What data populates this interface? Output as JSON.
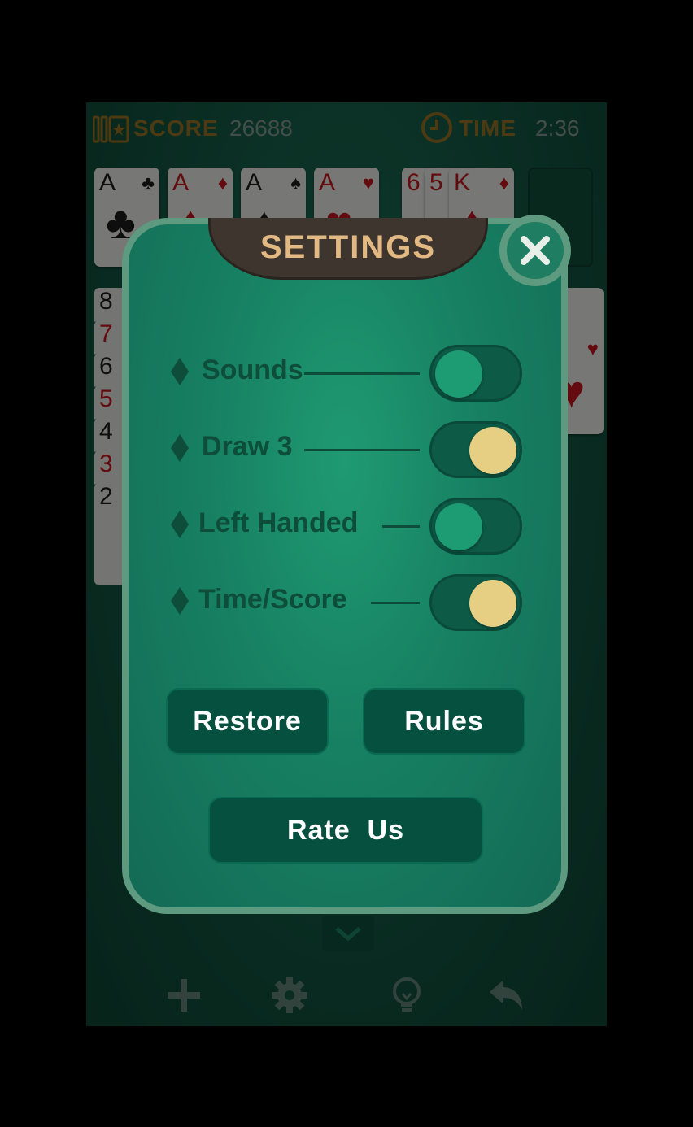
{
  "hud": {
    "score_label": "SCORE",
    "score_value": "26688",
    "time_label": "TIME",
    "time_value": "2:36"
  },
  "foundation": [
    {
      "rank": "A",
      "suit": "♣",
      "color": "black"
    },
    {
      "rank": "A",
      "suit": "♦",
      "color": "red"
    },
    {
      "rank": "A",
      "suit": "♠",
      "color": "black"
    },
    {
      "rank": "A",
      "suit": "♥",
      "color": "red"
    }
  ],
  "waste": [
    {
      "rank": "6",
      "suit": "",
      "color": "red"
    },
    {
      "rank": "5",
      "suit": "",
      "color": "red"
    },
    {
      "rank": "K",
      "suit": "♦",
      "color": "red"
    }
  ],
  "first_column": [
    {
      "rank": "8",
      "color": "black"
    },
    {
      "rank": "7",
      "color": "red"
    },
    {
      "rank": "6",
      "color": "black"
    },
    {
      "rank": "5",
      "color": "red"
    },
    {
      "rank": "4",
      "color": "black"
    },
    {
      "rank": "3",
      "color": "red"
    },
    {
      "rank": "2",
      "color": "black"
    }
  ],
  "right_card": {
    "suit": "♥",
    "color": "red"
  },
  "settings": {
    "title": "SETTINGS",
    "close_icon": "close-icon",
    "options": [
      {
        "label": "Sounds",
        "on": false
      },
      {
        "label": "Draw 3",
        "on": true
      },
      {
        "label": "Left Handed",
        "on": false
      },
      {
        "label": "Time/Score",
        "on": true
      }
    ],
    "restore_label": "Restore",
    "rules_label": "Rules",
    "rate_label": "Rate  Us"
  },
  "toolbar": {
    "icons": [
      "plus-icon",
      "gear-icon",
      "lightbulb-icon",
      "undo-icon"
    ]
  },
  "colors": {
    "felt": "#13523f",
    "dialog": "#178062",
    "dialog_border": "#5e9a80",
    "toggle_on_knob": "#e6cf82",
    "title_text": "#e2b983"
  }
}
